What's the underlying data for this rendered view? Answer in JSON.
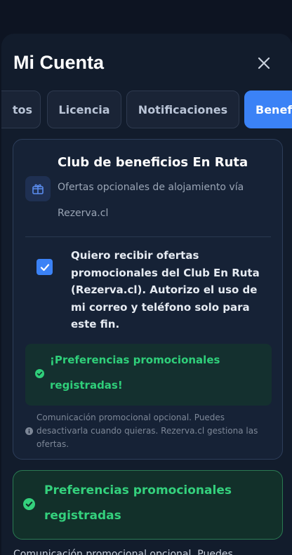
{
  "header": {
    "title": "Mi Cuenta"
  },
  "tabs": [
    {
      "label": "tos"
    },
    {
      "label": "Licencia"
    },
    {
      "label": "Notificaciones"
    },
    {
      "label": "Beneficios"
    }
  ],
  "club": {
    "title": "Club de beneficios En Ruta",
    "subtitle": "Ofertas opcionales de alojamiento vía Rezerva.cl",
    "consent_checked": true,
    "consent_text": "Quiero recibir ofertas promocionales del Club En Ruta (Rezerva.cl). Autorizo el uso de mi correo y teléfono solo para este fin.",
    "success_message": "¡Preferencias promocionales registradas!",
    "note": "Comunicación promocional opcional. Puedes desactivarla cuando quieras. Rezerva.cl gestiona las ofertas."
  },
  "banner": {
    "message": "Preferencias promocionales registradas"
  },
  "footer_partial": "Comunicación promocional opcional. Puedes",
  "colors": {
    "accent": "#3b82f6",
    "success": "#2fcf7a",
    "background": "#121c2c"
  }
}
